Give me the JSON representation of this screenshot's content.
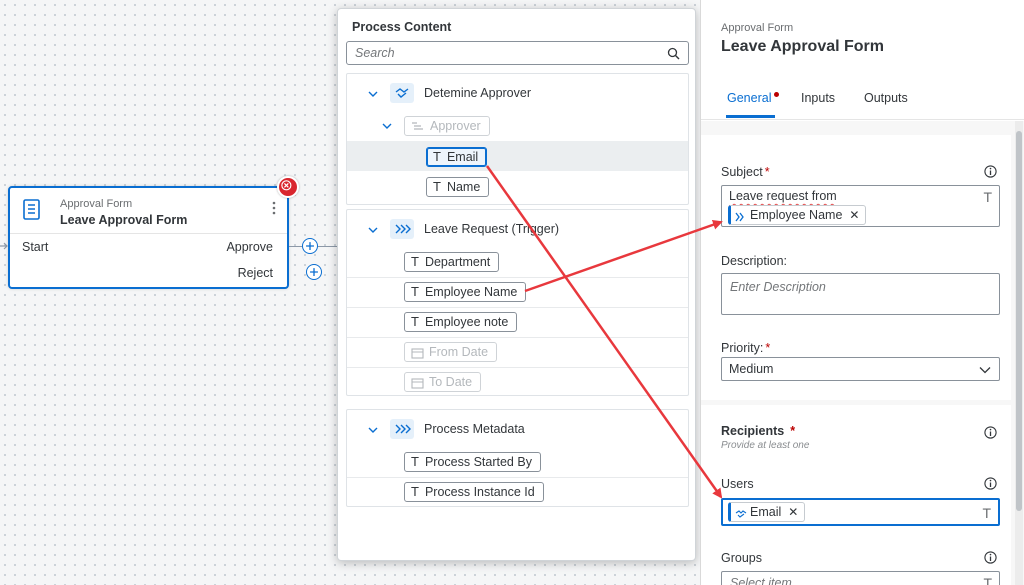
{
  "canvas": {
    "node": {
      "type": "Approval Form",
      "title": "Leave Approval Form",
      "start": "Start",
      "approve": "Approve",
      "reject": "Reject"
    }
  },
  "process_content": {
    "title": "Process Content",
    "search_placeholder": "Search",
    "groups": [
      {
        "label": "Detemine Approver",
        "sub_label": "Approver",
        "items": [
          "Email",
          "Name"
        ]
      },
      {
        "label": "Leave Request (Trigger)",
        "items": [
          "Department",
          "Employee Name",
          "Employee note",
          "From Date",
          "To Date"
        ]
      },
      {
        "label": "Process Metadata",
        "items": [
          "Process Started By",
          "Process Instance Id"
        ]
      }
    ]
  },
  "panel": {
    "type": "Approval Form",
    "title": "Leave Approval Form",
    "tabs": [
      "General",
      "Inputs",
      "Outputs"
    ],
    "subject": {
      "label": "Subject",
      "text": "Leave request from",
      "chip": "Employee Name"
    },
    "description": {
      "label": "Description:",
      "placeholder": "Enter Description"
    },
    "priority": {
      "label": "Priority:",
      "value": "Medium"
    },
    "recipients": {
      "label": "Recipients",
      "hint": "Provide at least one",
      "users_label": "Users",
      "users_chip": "Email",
      "groups_label": "Groups",
      "groups_placeholder": "Select item"
    }
  },
  "colors": {
    "accent": "#0a6ed1",
    "error": "#d9262e",
    "arrow": "#e8383d"
  }
}
